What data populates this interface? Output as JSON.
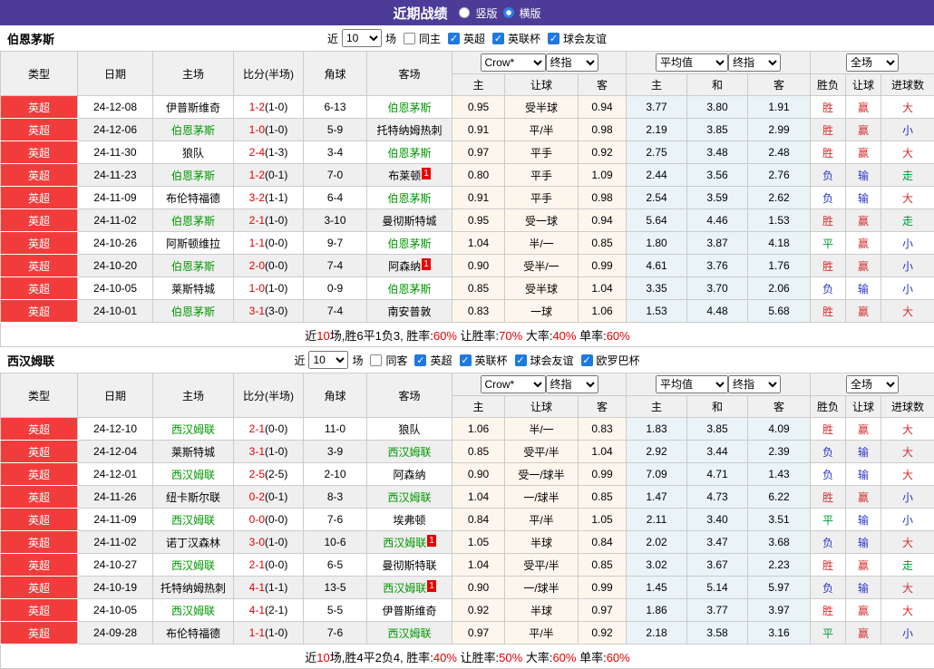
{
  "topbar": {
    "title": "近期战绩",
    "radios": [
      {
        "label": "竖版",
        "checked": false
      },
      {
        "label": "横版",
        "checked": true
      }
    ]
  },
  "colors": {
    "purple": "#4c3c97",
    "red": "#d42f2f",
    "blue": "#2b35c4",
    "green": "#009933",
    "team_green": "#009900",
    "score_red": "#e60000",
    "type_bg": "#f23c3c",
    "badge_bg": "#e60000",
    "summary_red": "#e60000"
  },
  "result_colors": {
    "胜": "red",
    "平": "green",
    "负": "blue",
    "赢": "red",
    "输": "blue",
    "走": "green",
    "大": "red",
    "小": "blue"
  },
  "columns_left": [
    "类型",
    "日期",
    "主场",
    "比分(半场)",
    "角球",
    "客场"
  ],
  "columns_right": [
    "主",
    "让球",
    "客",
    "主",
    "和",
    "客",
    "胜负",
    "让球",
    "进球数"
  ],
  "sections": [
    {
      "team": "伯恩茅斯",
      "controls": {
        "prefix": "近",
        "count": "10",
        "suffix": "场",
        "same": {
          "label": "同主",
          "checked": false
        },
        "leagues": [
          {
            "label": "英超",
            "checked": true
          },
          {
            "label": "英联杯",
            "checked": true
          },
          {
            "label": "球会友谊",
            "checked": true
          }
        ]
      },
      "dropdowns": {
        "bookmaker": "Crow*",
        "bk_stage": "终指",
        "average": "平均值",
        "avg_stage": "终指",
        "scope": "全场"
      },
      "rows": [
        {
          "lg": "英超",
          "date": "24-12-08",
          "home": "伊普斯维奇",
          "hf": false,
          "hb": "",
          "ft": "1-2",
          "ht": "(1-0)",
          "cn": "6-13",
          "away": "伯恩茅斯",
          "af": true,
          "ab": "",
          "w": "0.95",
          "h": "受半球",
          "l": "0.94",
          "a1": "3.77",
          "a2": "3.80",
          "a3": "1.91",
          "r1": "胜",
          "r2": "赢",
          "r3": "大"
        },
        {
          "lg": "英超",
          "date": "24-12-06",
          "home": "伯恩茅斯",
          "hf": true,
          "hb": "",
          "ft": "1-0",
          "ht": "(1-0)",
          "cn": "5-9",
          "away": "托特纳姆热刺",
          "af": false,
          "ab": "",
          "w": "0.91",
          "h": "平/半",
          "l": "0.98",
          "a1": "2.19",
          "a2": "3.85",
          "a3": "2.99",
          "r1": "胜",
          "r2": "赢",
          "r3": "小"
        },
        {
          "lg": "英超",
          "date": "24-11-30",
          "home": "狼队",
          "hf": false,
          "hb": "",
          "ft": "2-4",
          "ht": "(1-3)",
          "cn": "3-4",
          "away": "伯恩茅斯",
          "af": true,
          "ab": "",
          "w": "0.97",
          "h": "平手",
          "l": "0.92",
          "a1": "2.75",
          "a2": "3.48",
          "a3": "2.48",
          "r1": "胜",
          "r2": "赢",
          "r3": "大"
        },
        {
          "lg": "英超",
          "date": "24-11-23",
          "home": "伯恩茅斯",
          "hf": true,
          "hb": "",
          "ft": "1-2",
          "ht": "(0-1)",
          "cn": "7-0",
          "away": "布莱顿",
          "af": false,
          "ab": "1",
          "w": "0.80",
          "h": "平手",
          "l": "1.09",
          "a1": "2.44",
          "a2": "3.56",
          "a3": "2.76",
          "r1": "负",
          "r2": "输",
          "r3": "走"
        },
        {
          "lg": "英超",
          "date": "24-11-09",
          "home": "布伦特福德",
          "hf": false,
          "hb": "",
          "ft": "3-2",
          "ht": "(1-1)",
          "cn": "6-4",
          "away": "伯恩茅斯",
          "af": true,
          "ab": "",
          "w": "0.91",
          "h": "平手",
          "l": "0.98",
          "a1": "2.54",
          "a2": "3.59",
          "a3": "2.62",
          "r1": "负",
          "r2": "输",
          "r3": "大"
        },
        {
          "lg": "英超",
          "date": "24-11-02",
          "home": "伯恩茅斯",
          "hf": true,
          "hb": "",
          "ft": "2-1",
          "ht": "(1-0)",
          "cn": "3-10",
          "away": "曼彻斯特城",
          "af": false,
          "ab": "",
          "w": "0.95",
          "h": "受一球",
          "l": "0.94",
          "a1": "5.64",
          "a2": "4.46",
          "a3": "1.53",
          "r1": "胜",
          "r2": "赢",
          "r3": "走"
        },
        {
          "lg": "英超",
          "date": "24-10-26",
          "home": "阿斯顿维拉",
          "hf": false,
          "hb": "",
          "ft": "1-1",
          "ht": "(0-0)",
          "cn": "9-7",
          "away": "伯恩茅斯",
          "af": true,
          "ab": "",
          "w": "1.04",
          "h": "半/一",
          "l": "0.85",
          "a1": "1.80",
          "a2": "3.87",
          "a3": "4.18",
          "r1": "平",
          "r2": "赢",
          "r3": "小"
        },
        {
          "lg": "英超",
          "date": "24-10-20",
          "home": "伯恩茅斯",
          "hf": true,
          "hb": "",
          "ft": "2-0",
          "ht": "(0-0)",
          "cn": "7-4",
          "away": "阿森纳",
          "af": false,
          "ab": "1",
          "w": "0.90",
          "h": "受半/一",
          "l": "0.99",
          "a1": "4.61",
          "a2": "3.76",
          "a3": "1.76",
          "r1": "胜",
          "r2": "赢",
          "r3": "小"
        },
        {
          "lg": "英超",
          "date": "24-10-05",
          "home": "莱斯特城",
          "hf": false,
          "hb": "",
          "ft": "1-0",
          "ht": "(1-0)",
          "cn": "0-9",
          "away": "伯恩茅斯",
          "af": true,
          "ab": "",
          "w": "0.85",
          "h": "受半球",
          "l": "1.04",
          "a1": "3.35",
          "a2": "3.70",
          "a3": "2.06",
          "r1": "负",
          "r2": "输",
          "r3": "小"
        },
        {
          "lg": "英超",
          "date": "24-10-01",
          "home": "伯恩茅斯",
          "hf": true,
          "hb": "",
          "ft": "3-1",
          "ht": "(3-0)",
          "cn": "7-4",
          "away": "南安普敦",
          "af": false,
          "ab": "",
          "w": "0.83",
          "h": "一球",
          "l": "1.06",
          "a1": "1.53",
          "a2": "4.48",
          "a3": "5.68",
          "r1": "胜",
          "r2": "赢",
          "r3": "大"
        }
      ],
      "summary": [
        {
          "t": "近",
          "red": false
        },
        {
          "t": "10",
          "red": true
        },
        {
          "t": "场,胜6平1负3, 胜率:",
          "red": false
        },
        {
          "t": "60%",
          "red": true
        },
        {
          "t": " 让胜率:",
          "red": false
        },
        {
          "t": "70%",
          "red": true
        },
        {
          "t": " 大率:",
          "red": false
        },
        {
          "t": "40%",
          "red": true
        },
        {
          "t": " 单率:",
          "red": false
        },
        {
          "t": "60%",
          "red": true
        }
      ]
    },
    {
      "team": "西汉姆联",
      "controls": {
        "prefix": "近",
        "count": "10",
        "suffix": "场",
        "same": {
          "label": "同客",
          "checked": false
        },
        "leagues": [
          {
            "label": "英超",
            "checked": true
          },
          {
            "label": "英联杯",
            "checked": true
          },
          {
            "label": "球会友谊",
            "checked": true
          },
          {
            "label": "欧罗巴杯",
            "checked": true
          }
        ]
      },
      "dropdowns": {
        "bookmaker": "Crow*",
        "bk_stage": "终指",
        "average": "平均值",
        "avg_stage": "终指",
        "scope": "全场"
      },
      "rows": [
        {
          "lg": "英超",
          "date": "24-12-10",
          "home": "西汉姆联",
          "hf": true,
          "hb": "",
          "ft": "2-1",
          "ht": "(0-0)",
          "cn": "11-0",
          "away": "狼队",
          "af": false,
          "ab": "",
          "w": "1.06",
          "h": "半/一",
          "l": "0.83",
          "a1": "1.83",
          "a2": "3.85",
          "a3": "4.09",
          "r1": "胜",
          "r2": "赢",
          "r3": "大"
        },
        {
          "lg": "英超",
          "date": "24-12-04",
          "home": "莱斯特城",
          "hf": false,
          "hb": "",
          "ft": "3-1",
          "ht": "(1-0)",
          "cn": "3-9",
          "away": "西汉姆联",
          "af": true,
          "ab": "",
          "w": "0.85",
          "h": "受平/半",
          "l": "1.04",
          "a1": "2.92",
          "a2": "3.44",
          "a3": "2.39",
          "r1": "负",
          "r2": "输",
          "r3": "大"
        },
        {
          "lg": "英超",
          "date": "24-12-01",
          "home": "西汉姆联",
          "hf": true,
          "hb": "",
          "ft": "2-5",
          "ht": "(2-5)",
          "cn": "2-10",
          "away": "阿森纳",
          "af": false,
          "ab": "",
          "w": "0.90",
          "h": "受一/球半",
          "l": "0.99",
          "a1": "7.09",
          "a2": "4.71",
          "a3": "1.43",
          "r1": "负",
          "r2": "输",
          "r3": "大"
        },
        {
          "lg": "英超",
          "date": "24-11-26",
          "home": "纽卡斯尔联",
          "hf": false,
          "hb": "",
          "ft": "0-2",
          "ht": "(0-1)",
          "cn": "8-3",
          "away": "西汉姆联",
          "af": true,
          "ab": "",
          "w": "1.04",
          "h": "一/球半",
          "l": "0.85",
          "a1": "1.47",
          "a2": "4.73",
          "a3": "6.22",
          "r1": "胜",
          "r2": "赢",
          "r3": "小"
        },
        {
          "lg": "英超",
          "date": "24-11-09",
          "home": "西汉姆联",
          "hf": true,
          "hb": "",
          "ft": "0-0",
          "ht": "(0-0)",
          "cn": "7-6",
          "away": "埃弗顿",
          "af": false,
          "ab": "",
          "w": "0.84",
          "h": "平/半",
          "l": "1.05",
          "a1": "2.11",
          "a2": "3.40",
          "a3": "3.51",
          "r1": "平",
          "r2": "输",
          "r3": "小"
        },
        {
          "lg": "英超",
          "date": "24-11-02",
          "home": "诺丁汉森林",
          "hf": false,
          "hb": "",
          "ft": "3-0",
          "ht": "(1-0)",
          "cn": "10-6",
          "away": "西汉姆联",
          "af": true,
          "ab": "1",
          "w": "1.05",
          "h": "半球",
          "l": "0.84",
          "a1": "2.02",
          "a2": "3.47",
          "a3": "3.68",
          "r1": "负",
          "r2": "输",
          "r3": "大"
        },
        {
          "lg": "英超",
          "date": "24-10-27",
          "home": "西汉姆联",
          "hf": true,
          "hb": "",
          "ft": "2-1",
          "ht": "(0-0)",
          "cn": "6-5",
          "away": "曼彻斯特联",
          "af": false,
          "ab": "",
          "w": "1.04",
          "h": "受平/半",
          "l": "0.85",
          "a1": "3.02",
          "a2": "3.67",
          "a3": "2.23",
          "r1": "胜",
          "r2": "赢",
          "r3": "走"
        },
        {
          "lg": "英超",
          "date": "24-10-19",
          "home": "托特纳姆热刺",
          "hf": false,
          "hb": "",
          "ft": "4-1",
          "ht": "(1-1)",
          "cn": "13-5",
          "away": "西汉姆联",
          "af": true,
          "ab": "1",
          "w": "0.90",
          "h": "一/球半",
          "l": "0.99",
          "a1": "1.45",
          "a2": "5.14",
          "a3": "5.97",
          "r1": "负",
          "r2": "输",
          "r3": "大"
        },
        {
          "lg": "英超",
          "date": "24-10-05",
          "home": "西汉姆联",
          "hf": true,
          "hb": "",
          "ft": "4-1",
          "ht": "(2-1)",
          "cn": "5-5",
          "away": "伊普斯维奇",
          "af": false,
          "ab": "",
          "w": "0.92",
          "h": "半球",
          "l": "0.97",
          "a1": "1.86",
          "a2": "3.77",
          "a3": "3.97",
          "r1": "胜",
          "r2": "赢",
          "r3": "大"
        },
        {
          "lg": "英超",
          "date": "24-09-28",
          "home": "布伦特福德",
          "hf": false,
          "hb": "",
          "ft": "1-1",
          "ht": "(1-0)",
          "cn": "7-6",
          "away": "西汉姆联",
          "af": true,
          "ab": "",
          "w": "0.97",
          "h": "平/半",
          "l": "0.92",
          "a1": "2.18",
          "a2": "3.58",
          "a3": "3.16",
          "r1": "平",
          "r2": "赢",
          "r3": "小"
        }
      ],
      "summary": [
        {
          "t": "近",
          "red": false
        },
        {
          "t": "10",
          "red": true
        },
        {
          "t": "场,胜4平2负4, 胜率:",
          "red": false
        },
        {
          "t": "40%",
          "red": true
        },
        {
          "t": " 让胜率:",
          "red": false
        },
        {
          "t": "50%",
          "red": true
        },
        {
          "t": " 大率:",
          "red": false
        },
        {
          "t": "60%",
          "red": true
        },
        {
          "t": " 单率:",
          "red": false
        },
        {
          "t": "60%",
          "red": true
        }
      ]
    }
  ]
}
